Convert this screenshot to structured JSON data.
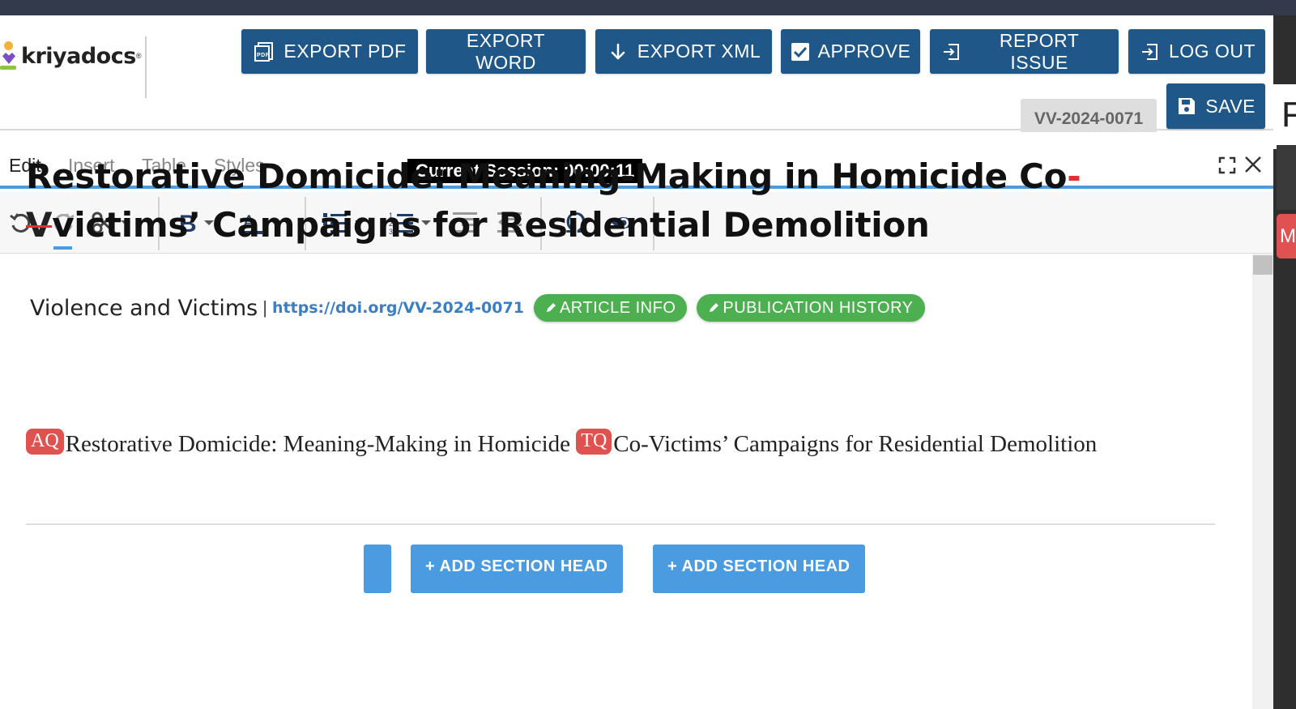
{
  "brand": {
    "name": "kriyadocs",
    "reg": "®"
  },
  "header": {
    "buttons": {
      "export_pdf": "EXPORT PDF",
      "export_word": "EXPORT WORD",
      "export_xml": "EXPORT XML",
      "approve": "APPROVE",
      "report_issue": "REPORT ISSUE",
      "log_out": "LOG OUT",
      "save": "SAVE"
    },
    "doc_id": "VV-2024-0071"
  },
  "editor": {
    "tabs": [
      "Edit",
      "Insert",
      "Table",
      "Styles"
    ],
    "active_tab": "Edit",
    "session": "Current Session: 00:00:11",
    "toolbar_icons": [
      "undo-icon",
      "redo-icon",
      "cut-icon",
      "bold-icon",
      "text-color-icon",
      "bullet-list-icon",
      "numbered-list-icon",
      "indent-icon",
      "outdent-icon",
      "special-char-icon",
      "preview-icon"
    ]
  },
  "article": {
    "journal": "Violence and Victims",
    "separator": "|",
    "doi": "https://doi.org/VV-2024-0071",
    "article_info": "ARTICLE INFO",
    "publication_history": "PUBLICATION HISTORY",
    "title_part1": "Restorative Domicide: Meaning-Making in Homicide Co",
    "title_dash": "-",
    "title_deleted": "V",
    "title_inserted": "v",
    "title_part2": "ictims’ Campaigns for Residential Demolition",
    "query_aq": "AQ",
    "subtitle_part1": "Restorative Domicide: Meaning-Making in Homicide ",
    "query_tq": "TQ",
    "subtitle_part2": "Co-Victims’ Campaigns for Residential Demolition",
    "add_section_head_1": "+ ADD SECTION HEAD",
    "add_section_head_2": "+ ADD SECTION HEAD"
  },
  "side_panel": {
    "letter": "F",
    "tab_letter": "M"
  },
  "colors": {
    "header_button": "#1f5788",
    "accent_blue": "#4a9be0",
    "pill_green": "#4caf50",
    "query_red": "#e0524f",
    "top_strip": "#333a4b"
  }
}
